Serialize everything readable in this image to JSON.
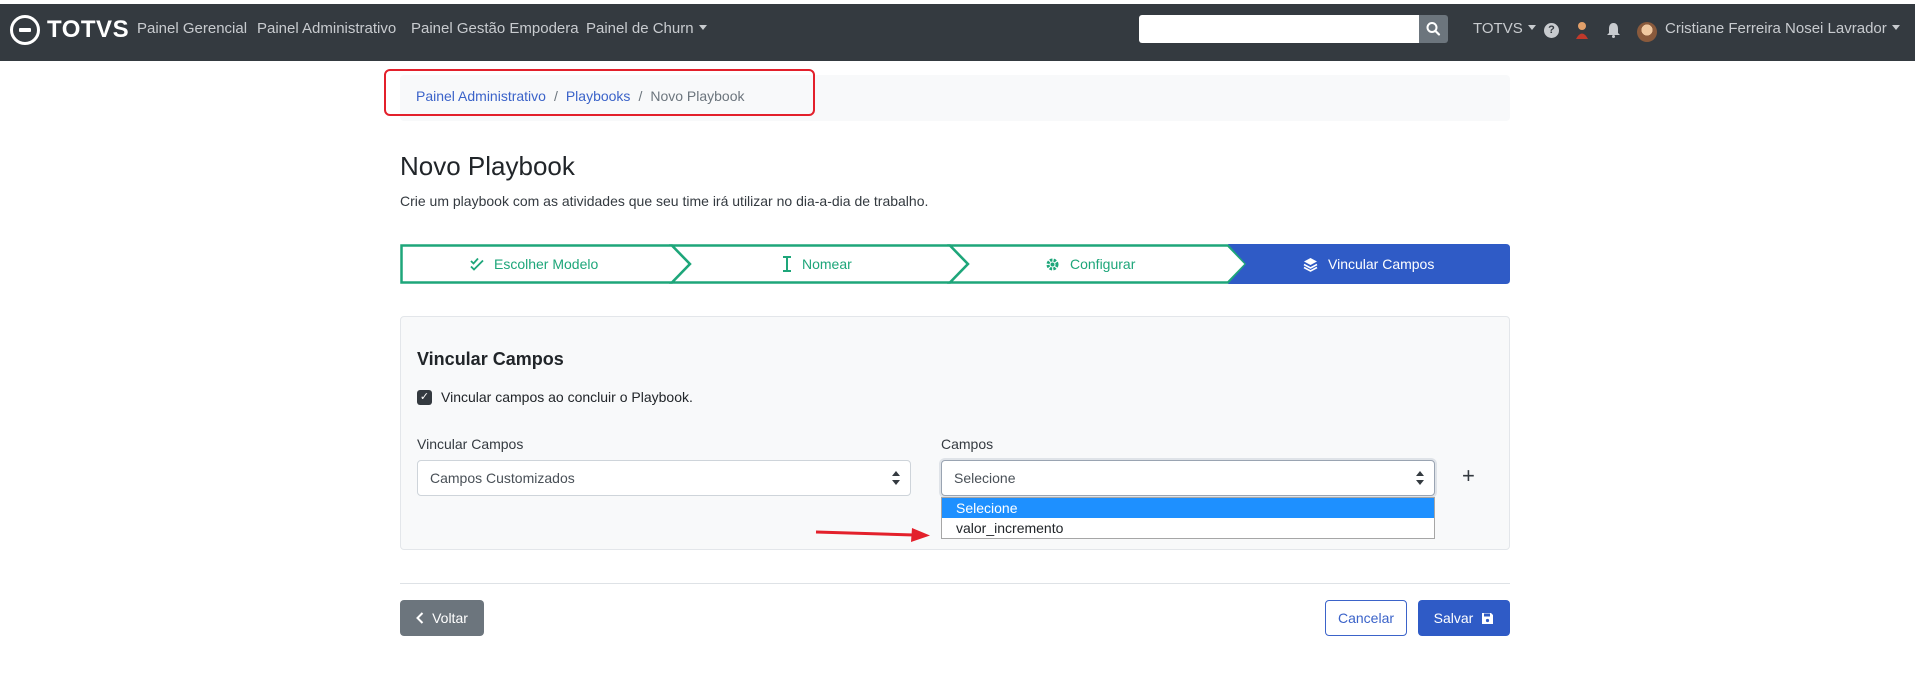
{
  "brand": {
    "name": "TOTVS"
  },
  "nav": {
    "items": [
      "Painel Gerencial",
      "Painel Administrativo",
      "Painel Gestão Empodera",
      "Painel de Churn"
    ],
    "search_placeholder": "",
    "org_menu": "TOTVS",
    "user_name": "Cristiane Ferreira Nosei Lavrador"
  },
  "breadcrumb": [
    "Painel Administrativo",
    "Playbooks",
    "Novo Playbook"
  ],
  "page": {
    "title": "Novo Playbook",
    "subtitle": "Crie um playbook com as atividades que seu time irá utilizar no dia-a-dia de trabalho."
  },
  "steps": [
    {
      "label": "Escolher Modelo",
      "icon": "double-check-icon",
      "state": "done"
    },
    {
      "label": "Nomear",
      "icon": "text-cursor-icon",
      "state": "done"
    },
    {
      "label": "Configurar",
      "icon": "gear-icon",
      "state": "done"
    },
    {
      "label": "Vincular Campos",
      "icon": "layers-icon",
      "state": "active"
    }
  ],
  "form": {
    "card_title": "Vincular Campos",
    "checkbox_label": "Vincular campos ao concluir o Playbook.",
    "checkbox_checked": true,
    "left_label": "Vincular Campos",
    "left_value": "Campos Customizados",
    "right_label": "Campos",
    "right_value": "Selecione",
    "add_symbol": "+",
    "dropdown_options": [
      "Selecione",
      "valor_incremento"
    ],
    "dropdown_selected_index": 0
  },
  "footer": {
    "back": "Voltar",
    "cancel": "Cancelar",
    "save": "Salvar"
  },
  "colors": {
    "topbar": "#343a40",
    "step_done": "#1ea67a",
    "step_active": "#2f5bc6",
    "annotation": "#e3202b"
  }
}
